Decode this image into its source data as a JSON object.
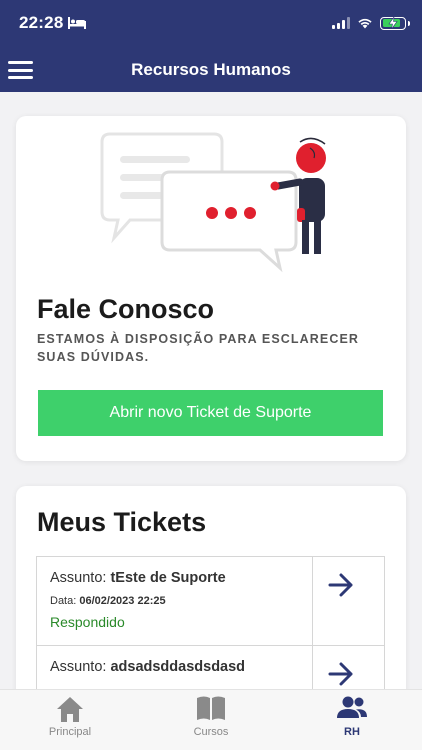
{
  "status_bar": {
    "time": "22:28"
  },
  "header": {
    "title": "Recursos Humanos"
  },
  "contact_card": {
    "title": "Fale Conosco",
    "subtitle": "ESTAMOS À DISPOSIÇÃO PARA ESCLARECER SUAS DÚVIDAS.",
    "button_label": "Abrir novo Ticket de Suporte"
  },
  "tickets_card": {
    "title": "Meus Tickets",
    "subject_label": "Assunto:",
    "date_label": "Data:",
    "tickets": [
      {
        "subject": "tEste de Suporte",
        "date": "06/02/2023 22:25",
        "status": "Respondido"
      },
      {
        "subject": "adsadsddasdsdasd"
      }
    ]
  },
  "tabbar": {
    "tabs": [
      {
        "label": "Principal",
        "icon": "home-icon"
      },
      {
        "label": "Cursos",
        "icon": "book-icon"
      },
      {
        "label": "RH",
        "icon": "people-icon",
        "active": true
      }
    ]
  },
  "colors": {
    "primary": "#2d3875",
    "accent_red": "#e0202e",
    "button_green": "#3ed06b",
    "status_green": "#2a8a2a"
  }
}
